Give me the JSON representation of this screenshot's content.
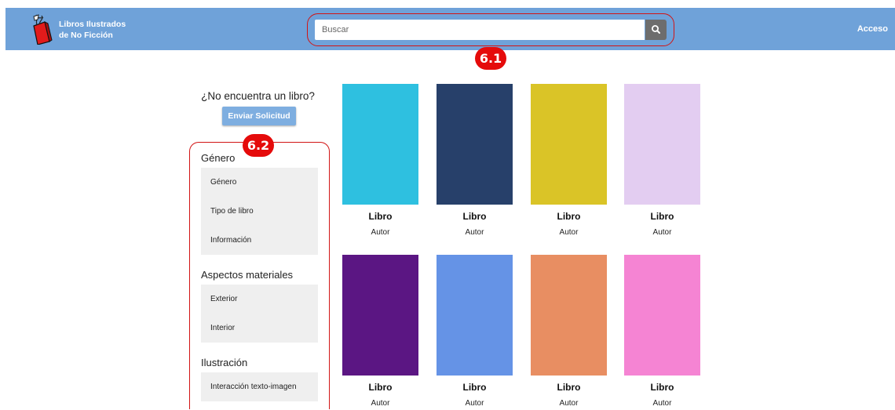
{
  "header": {
    "brand_line1": "Libros Ilustrados",
    "brand_line2": "de No Ficción",
    "login": "Acceso",
    "bg_color": "#6fa2d9"
  },
  "search": {
    "placeholder": "Buscar",
    "value": "",
    "button_icon": "search-icon"
  },
  "annotations": {
    "badge1": "6.1",
    "badge2": "6.2",
    "color": "#e50b0b"
  },
  "sidebar": {
    "question": "¿No encuentra un libro?",
    "request_button": "Enviar Solicitud",
    "sections": [
      {
        "title": "Género",
        "items": [
          "Género",
          "Tipo de libro",
          "Información"
        ]
      },
      {
        "title": "Aspectos materiales",
        "items": [
          "Exterior",
          "Interior"
        ]
      },
      {
        "title": "Ilustración",
        "items": [
          "Interacción texto-imagen"
        ]
      }
    ]
  },
  "books": [
    {
      "title": "Libro",
      "author": "Autor",
      "color": "#2ec0e0"
    },
    {
      "title": "Libro",
      "author": "Autor",
      "color": "#27406a"
    },
    {
      "title": "Libro",
      "author": "Autor",
      "color": "#dac427"
    },
    {
      "title": "Libro",
      "author": "Autor",
      "color": "#e3cdf1"
    },
    {
      "title": "Libro",
      "author": "Autor",
      "color": "#5b1683"
    },
    {
      "title": "Libro",
      "author": "Autor",
      "color": "#6593e6"
    },
    {
      "title": "Libro",
      "author": "Autor",
      "color": "#e88e62"
    },
    {
      "title": "Libro",
      "author": "Autor",
      "color": "#f584d3"
    }
  ]
}
